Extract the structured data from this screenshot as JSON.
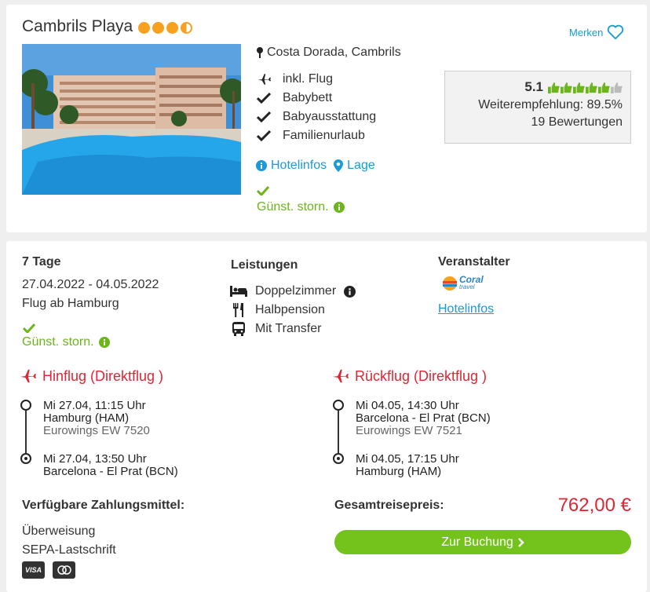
{
  "hotel": {
    "name": "Cambrils Playa",
    "stars": 3.5,
    "favorite_label": "Merken",
    "location": "Costa Dorada, Cambrils",
    "features": [
      "inkl. Flug",
      "Babybett",
      "Babyausstattung",
      "Familienurlaub"
    ],
    "links": {
      "hotelinfos": "Hotelinfos",
      "lage": "Lage"
    },
    "storno": "Günst. storn."
  },
  "rating": {
    "score": "5.1",
    "score_out_of": 6,
    "recommendation": "Weiterempfehlung: 89.5%",
    "reviews": "19 Bewertungen"
  },
  "offer": {
    "duration": "7 Tage",
    "dates": "27.04.2022 - 04.05.2022",
    "departure": "Flug ab Hamburg",
    "storno": "Günst. storn.",
    "services_heading": "Leistungen",
    "services": [
      "Doppelzimmer",
      "Halbpension",
      "Mit Transfer"
    ],
    "operator_heading": "Veranstalter",
    "operator_logo": "Coral",
    "operator_logo_sub": "travel",
    "operator_link": "Hotelinfos"
  },
  "outbound": {
    "heading": "Hinflug (Direktflug )",
    "dep_time": "Mi 27.04, 11:15 Uhr",
    "dep_airport": "Hamburg (HAM)",
    "flight_no": "Eurowings EW 7520",
    "arr_time": "Mi 27.04, 13:50 Uhr",
    "arr_airport": "Barcelona - El Prat (BCN)"
  },
  "return": {
    "heading": "Rückflug (Direktflug )",
    "dep_time": "Mi 04.05, 14:30 Uhr",
    "dep_airport": "Barcelona - El Prat (BCN)",
    "flight_no": "Eurowings EW 7521",
    "arr_time": "Mi 04.05, 17:15 Uhr",
    "arr_airport": "Hamburg (HAM)"
  },
  "payment": {
    "heading": "Verfügbare Zahlungsmittel:",
    "methods": [
      "Überweisung",
      "SEPA-Lastschrift"
    ],
    "card_icons": [
      "visa-icon",
      "mastercard-icon"
    ],
    "visa_label": "VISA"
  },
  "total": {
    "label": "Gesamtreisepreis:",
    "price": "762,00 €",
    "button": "Zur Buchung"
  },
  "colors": {
    "accent_blue": "#1a9ad6",
    "green": "#6cb51b",
    "red": "#e02535",
    "star": "#f7a120"
  }
}
